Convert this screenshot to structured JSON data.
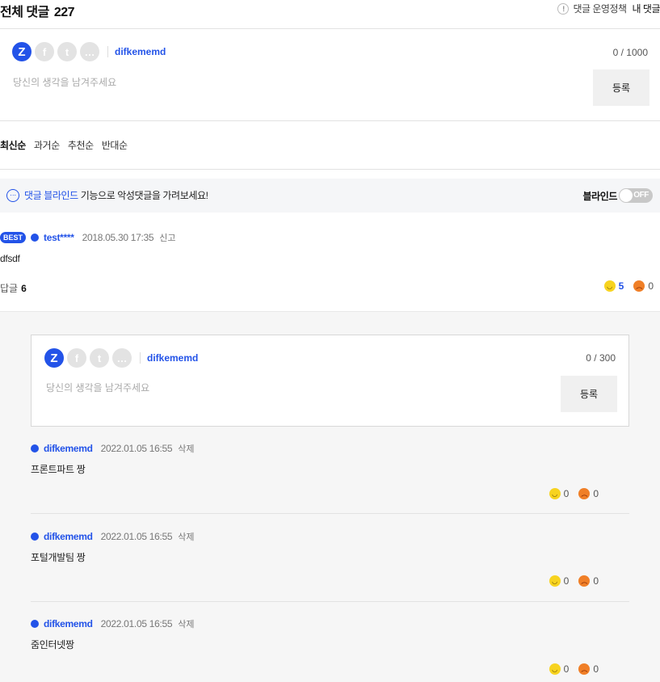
{
  "header": {
    "title": "전체 댓글",
    "count": "227",
    "policy_icon": "!",
    "policy_label": "댓글 운영정책",
    "my_comments_label": "내 댓글"
  },
  "composer": {
    "sns_icons": [
      "kakao-z-icon",
      "facebook-icon",
      "twitter-icon",
      "chat-icon"
    ],
    "z_glyph": "Z",
    "fb_glyph": "f",
    "tw_glyph": "t",
    "chat_glyph": "…",
    "username": "difkememd",
    "char_count": "0 / 1000",
    "placeholder": "당신의 생각을 남겨주세요",
    "submit_label": "등록"
  },
  "sort_tabs": [
    {
      "label": "최신순",
      "active": true
    },
    {
      "label": "과거순",
      "active": false
    },
    {
      "label": "추천순",
      "active": false
    },
    {
      "label": "반대순",
      "active": false
    }
  ],
  "blind": {
    "link_text": "댓글 블라인드",
    "message": "기능으로 악성댓글을 가려보세요!",
    "toggle_label": "블라인드",
    "toggle_state": "OFF",
    "icon_glyph": "···"
  },
  "best_comment": {
    "badge": "BEST",
    "author": "test****",
    "date": "2018.05.30 17:35",
    "action": "신고",
    "text": "dfsdf",
    "reply_label": "답글",
    "reply_count": "6",
    "likes": "5",
    "dislikes": "0"
  },
  "reply_composer": {
    "username": "difkememd",
    "char_count": "0 / 300",
    "placeholder": "당신의 생각을 남겨주세요",
    "submit_label": "등록"
  },
  "replies": [
    {
      "author": "difkememd",
      "date": "2022.01.05 16:55",
      "action": "삭제",
      "text": "프론트파트 짱",
      "likes": "0",
      "dislikes": "0"
    },
    {
      "author": "difkememd",
      "date": "2022.01.05 16:55",
      "action": "삭제",
      "text": "포털개발팀 짱",
      "likes": "0",
      "dislikes": "0"
    },
    {
      "author": "difkememd",
      "date": "2022.01.05 16:55",
      "action": "삭제",
      "text": "줌인터넷짱",
      "likes": "0",
      "dislikes": "0"
    }
  ],
  "colors": {
    "accent": "#2353e8",
    "like": "#f7d31f",
    "dislike": "#f07f27",
    "toggle_off": "#c8c8c8"
  }
}
